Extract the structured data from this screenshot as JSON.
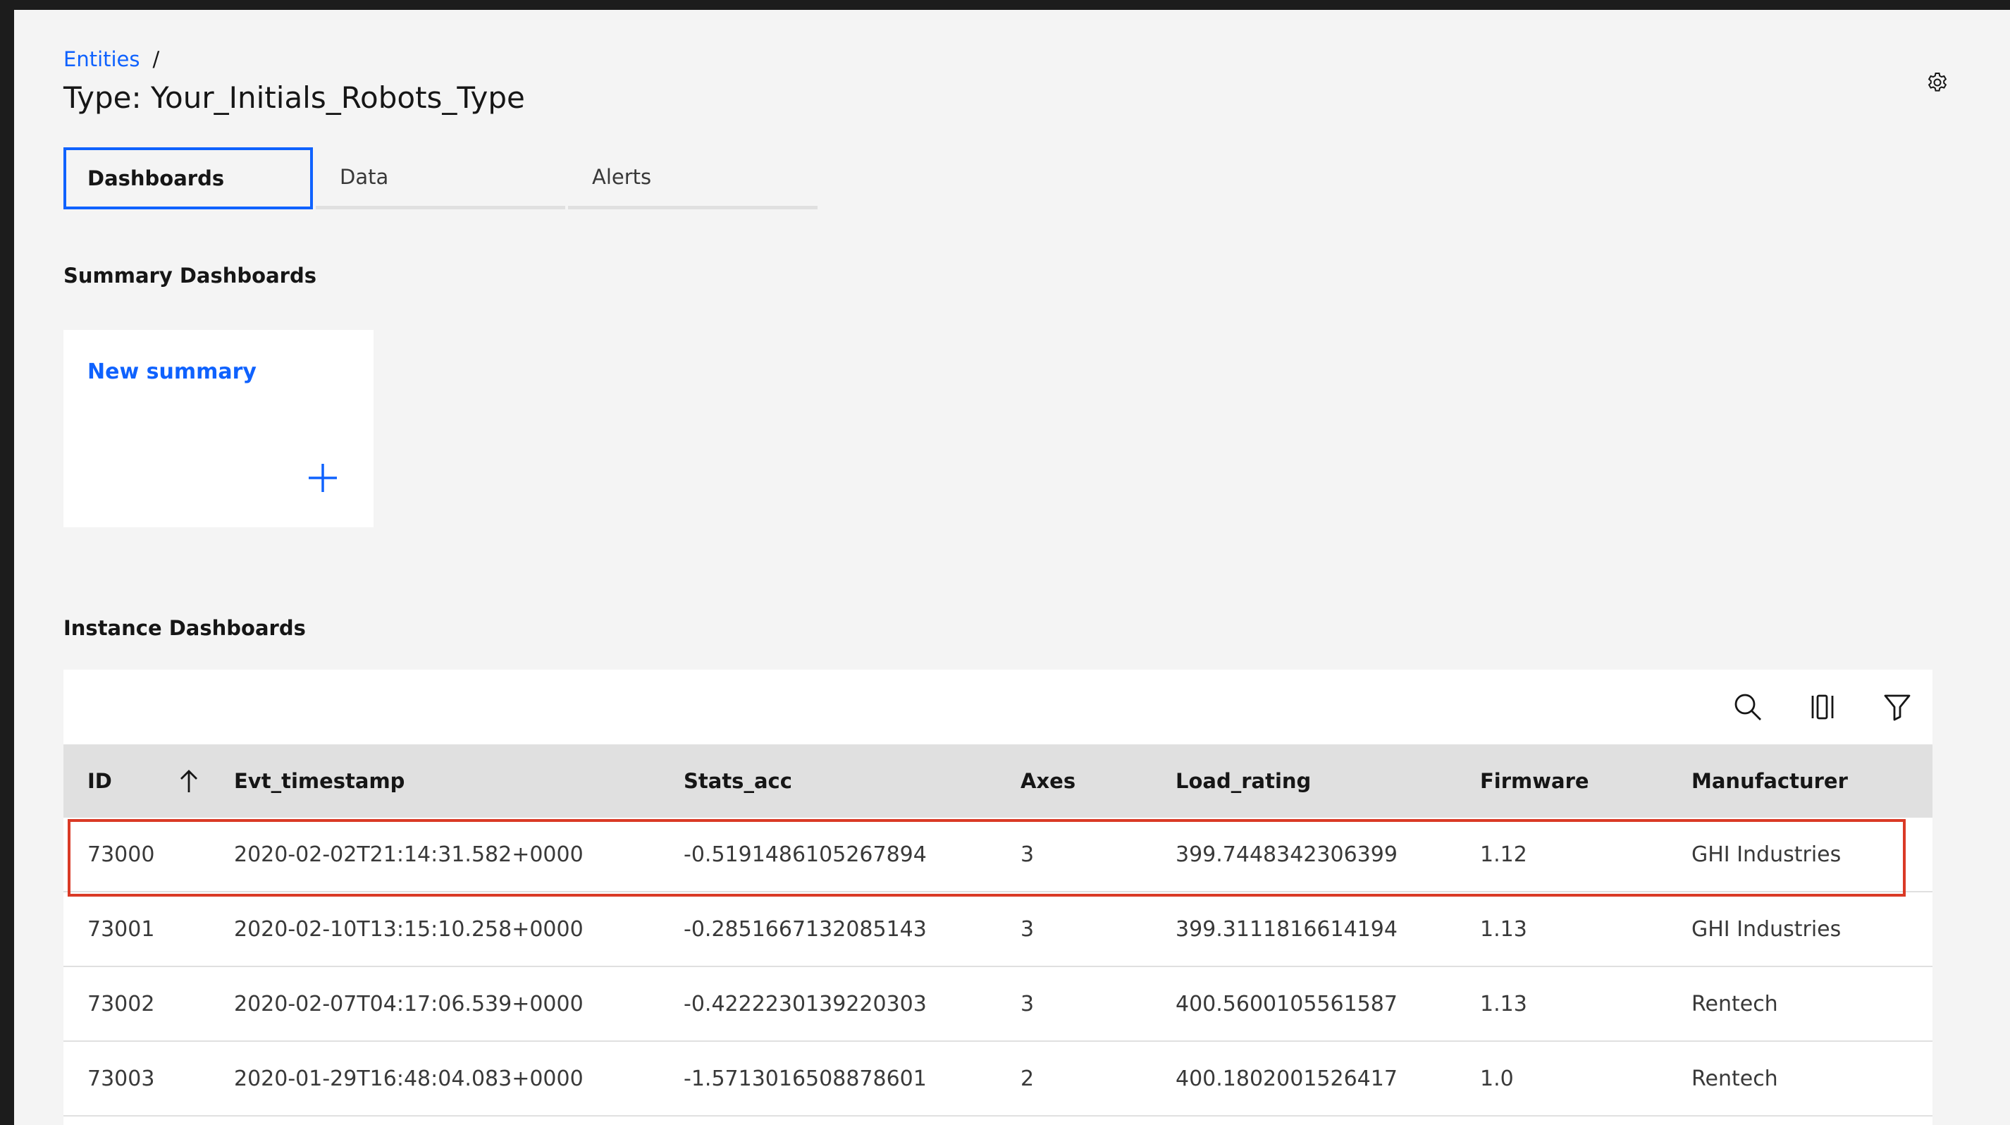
{
  "breadcrumb": {
    "link": "Entities",
    "separator": "/"
  },
  "page": {
    "title": "Type: Your_Initials_Robots_Type"
  },
  "icons": {
    "settings": "gear-icon",
    "search": "search-icon",
    "columns": "columns-icon",
    "filter": "filter-icon",
    "sort": "arrow-up-icon",
    "add": "plus-icon"
  },
  "tabs": [
    {
      "label": "Dashboards",
      "active": true
    },
    {
      "label": "Data",
      "active": false
    },
    {
      "label": "Alerts",
      "active": false
    }
  ],
  "summary": {
    "heading": "Summary Dashboards",
    "tile_label": "New summary"
  },
  "instance": {
    "heading": "Instance Dashboards",
    "columns": [
      "ID",
      "Evt_timestamp",
      "Stats_acc",
      "Axes",
      "Load_rating",
      "Firmware",
      "Manufacturer"
    ],
    "rows": [
      [
        "73000",
        "2020-02-02T21:14:31.582+0000",
        "-0.5191486105267894",
        "3",
        "399.7448342306399",
        "1.12",
        "GHI Industries"
      ],
      [
        "73001",
        "2020-02-10T13:15:10.258+0000",
        "-0.2851667132085143",
        "3",
        "399.3111816614194",
        "1.13",
        "GHI Industries"
      ],
      [
        "73002",
        "2020-02-07T04:17:06.539+0000",
        "-0.4222230139220303",
        "3",
        "400.5600105561587",
        "1.13",
        "Rentech"
      ],
      [
        "73003",
        "2020-01-29T16:48:04.083+0000",
        "-1.5713016508878601",
        "2",
        "400.1802001526417",
        "1.0",
        "Rentech"
      ]
    ]
  },
  "colors": {
    "accent": "#0f62fe",
    "highlight": "#da3a26",
    "background": "#f4f4f4",
    "header_row": "#e0e0e0"
  }
}
